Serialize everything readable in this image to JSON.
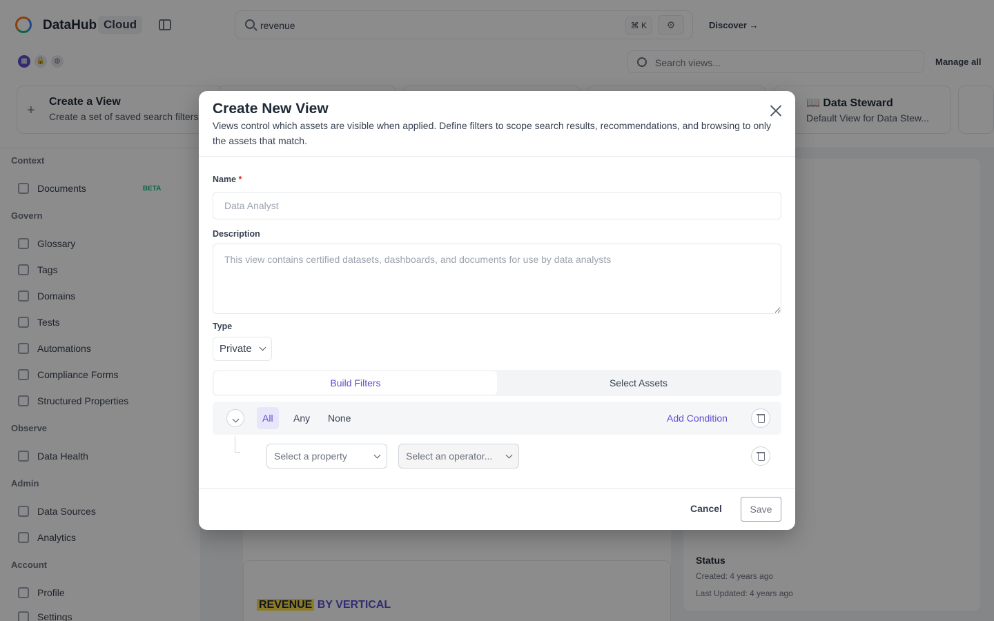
{
  "app": {
    "brand": "DataHub",
    "edition": "Cloud"
  },
  "search": {
    "query": "revenue",
    "shortcut": "⌘ K"
  },
  "header": {
    "discover_label": "Discover →"
  },
  "views_bar": {
    "search_placeholder": "Search views...",
    "manage_all": "Manage all",
    "cards": [
      {
        "title": "Create a View",
        "subtitle": "Create a set of saved search filters"
      },
      {
        "title": "📖 Data Steward",
        "subtitle": "Default View for Data Stew..."
      }
    ]
  },
  "sidebar": {
    "sections": [
      "Context",
      "Govern",
      "Observe",
      "Admin",
      "Account"
    ],
    "items": [
      "Documents",
      "Glossary",
      "Tags",
      "Domains",
      "Tests",
      "Automations",
      "Compliance Forms",
      "Structured Properties",
      "Data Health",
      "Data Sources",
      "Analytics",
      "Profile",
      "Settings"
    ],
    "beta": "BETA"
  },
  "background": {
    "entity_title_highlight": "REVENUE",
    "entity_title_rest": " BY VERTICAL",
    "status_label": "Status",
    "created": "Created: 4 years ago",
    "updated": "Last Updated: 4 years ago"
  },
  "modal": {
    "title": "Create New View",
    "description": "Views control which assets are visible when applied. Define filters to scope search results, recommendations, and browsing to only the assets that match.",
    "name_label": "Name",
    "name_required": "*",
    "name_placeholder": "Data Analyst",
    "description_label": "Description",
    "description_placeholder": "This view contains certified datasets, dashboards, and documents for use by data analysts",
    "type_label": "Type",
    "type_value": "Private",
    "tabs": [
      "Build Filters",
      "Select Assets"
    ],
    "logic_options": [
      "All",
      "Any",
      "None"
    ],
    "add_condition": "Add Condition",
    "property_placeholder": "Select a property",
    "operator_placeholder": "Select an operator...",
    "cancel": "Cancel",
    "save": "Save"
  },
  "colors": {
    "accent": "#5b4fcf",
    "overlay": "rgba(0,0,0,0.45)"
  }
}
